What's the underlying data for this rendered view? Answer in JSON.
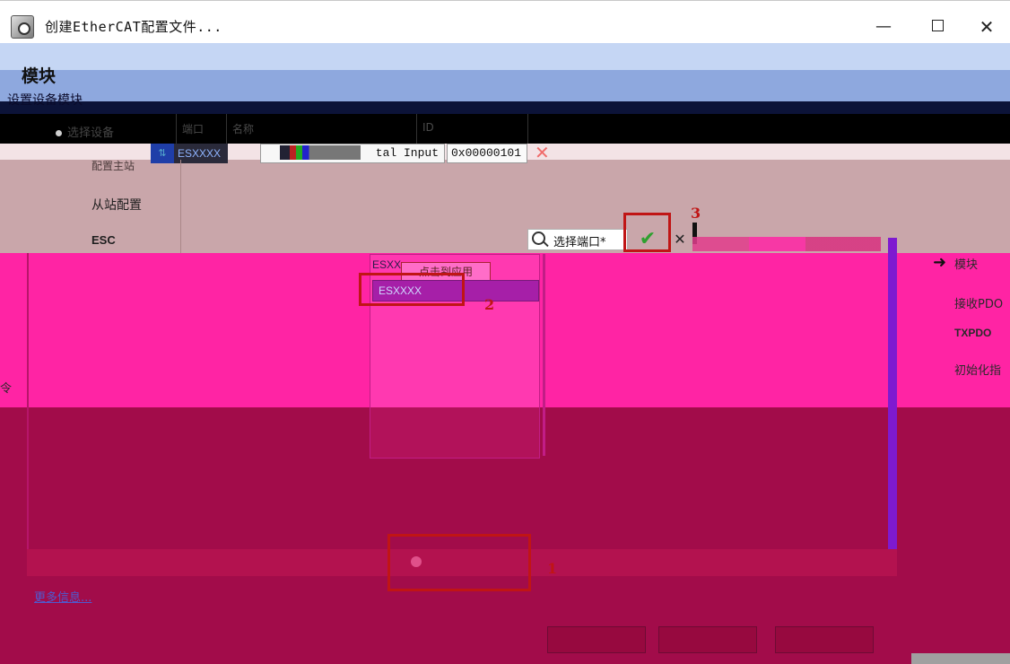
{
  "window": {
    "title": "创建EtherCAT配置文件...",
    "minimize_glyph": "—",
    "close_glyph": "✕"
  },
  "page": {
    "heading": "模块",
    "subtitle": "设置设备模块"
  },
  "left_nav": {
    "select_device": "选择设备",
    "items": [
      "配置主站",
      "从站配置",
      "ESC"
    ]
  },
  "module_grid": {
    "columns": [
      "端口",
      "名称",
      "ID"
    ],
    "rows": [
      {
        "port": "ESXXXX",
        "name": "tal Input",
        "id": "0x00000101"
      }
    ]
  },
  "port_selector": {
    "placeholder": "选择端口*",
    "confirm_glyph": "✔",
    "cancel_glyph": "✕"
  },
  "dropdown": {
    "current_value": "ESXX",
    "tooltip": "点击到应用",
    "options": [
      "ESXXXX"
    ]
  },
  "right_nav": {
    "items": [
      "模块",
      "接收PDO",
      "TXPDO",
      "初始化指"
    ]
  },
  "footer": {
    "more_info": "更多信息..."
  },
  "annotations": {
    "step1": "1",
    "step2": "2",
    "step3": "3",
    "color": "#c01515"
  },
  "left_fragment": "令",
  "icons": {
    "app": "app-icon",
    "search": "search-icon",
    "confirm": "check-icon",
    "cancel": "close-icon",
    "delete": "delete-icon",
    "arrow": "arrow-right-icon"
  }
}
